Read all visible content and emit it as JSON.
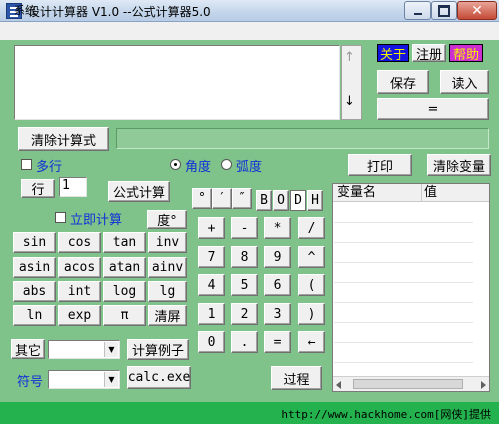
{
  "window": {
    "title": "设计计算器 V1.0 --公式计算器5.0",
    "close_glyph": "✕"
  },
  "menu": {
    "items": [
      "系统"
    ]
  },
  "top_buttons": {
    "about": "关于",
    "register": "注册",
    "help": "帮助",
    "save": "保存",
    "read": "读入",
    "equals": "="
  },
  "scroll": {
    "up": "↑",
    "down": "↓"
  },
  "clear_formula": "清除计算式",
  "options": {
    "multiline": "多行",
    "degree": "角度",
    "radian": "弧度",
    "line_label": "行",
    "line_value": "1",
    "formula_calc": "公式计算",
    "immediate": "立即计算",
    "degree_btn": "度°"
  },
  "right_buttons": {
    "print": "打印",
    "clear_vars": "清除变量"
  },
  "sexagesimal": [
    "°",
    "′",
    "″"
  ],
  "bases": [
    "B",
    "O",
    "D",
    "H"
  ],
  "functions": [
    [
      "sin",
      "cos",
      "tan",
      "inv"
    ],
    [
      "asin",
      "acos",
      "atan",
      "ainv"
    ],
    [
      "abs",
      "int",
      "log",
      "lg"
    ],
    [
      "ln",
      "exp",
      "π",
      "清屏"
    ]
  ],
  "keypad": [
    [
      "+",
      "-",
      "*",
      "/"
    ],
    [
      "7",
      "8",
      "9",
      "^"
    ],
    [
      "4",
      "5",
      "6",
      "("
    ],
    [
      "1",
      "2",
      "3",
      ")"
    ],
    [
      "0",
      ".",
      "=",
      "←"
    ]
  ],
  "variables": {
    "col_name": "变量名",
    "col_value": "值"
  },
  "bottom": {
    "other_label": "其它",
    "symbol_label": "符号",
    "example": "计算例子",
    "calcexe": "calc.exe",
    "process": "过程"
  },
  "status": "http://www.hackhome.com[网侠]提供"
}
